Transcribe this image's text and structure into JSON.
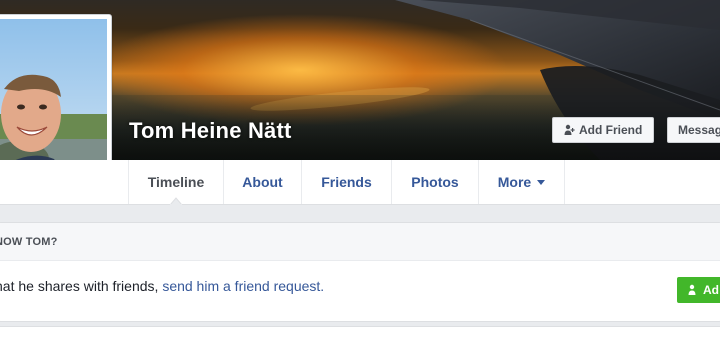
{
  "profile": {
    "name": "Tom Heine Nätt"
  },
  "cover_actions": {
    "add_friend_label": "Add Friend",
    "message_label": "Messag",
    "add_friend_icon": "person-plus-icon"
  },
  "nav": {
    "tabs": [
      {
        "label": "Timeline",
        "active": true
      },
      {
        "label": "About",
        "active": false
      },
      {
        "label": "Friends",
        "active": false
      },
      {
        "label": "Photos",
        "active": false
      },
      {
        "label": "More",
        "active": false,
        "icon": "caret-down-icon"
      }
    ]
  },
  "know_card": {
    "heading": "NOW TOM?",
    "text_prefix": "hat he shares with friends, ",
    "link_text": "send him a friend request.",
    "button_label": "Ad"
  },
  "colors": {
    "link": "#365899",
    "button_green": "#42b72a",
    "page_bg": "#e9ebee"
  }
}
